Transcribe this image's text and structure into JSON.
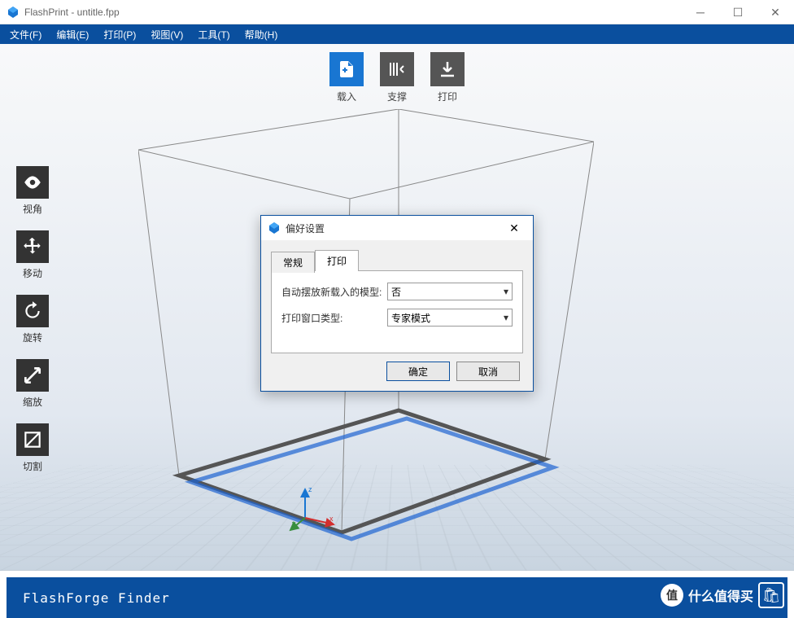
{
  "titlebar": {
    "text": "FlashPrint - untitle.fpp"
  },
  "menu": {
    "file": "文件(F)",
    "edit": "编辑(E)",
    "print": "打印(P)",
    "view": "视图(V)",
    "tools": "工具(T)",
    "help": "帮助(H)"
  },
  "top_toolbar": {
    "load": "载入",
    "support": "支撑",
    "print": "打印"
  },
  "left_toolbar": {
    "view": "视角",
    "move": "移动",
    "rotate": "旋转",
    "scale": "缩放",
    "cut": "切割"
  },
  "dialog": {
    "title": "偏好设置",
    "tabs": {
      "general": "常规",
      "print": "打印"
    },
    "fields": {
      "auto_place_label": "自动摆放新载入的模型:",
      "auto_place_value": "否",
      "window_type_label": "打印窗口类型:",
      "window_type_value": "专家模式"
    },
    "buttons": {
      "ok": "确定",
      "cancel": "取消"
    }
  },
  "statusbar": {
    "text": "FlashForge Finder"
  },
  "axis": {
    "x": "x",
    "y": "y",
    "z": "z"
  },
  "watermark": {
    "badge": "值",
    "text": "什么值得买"
  }
}
